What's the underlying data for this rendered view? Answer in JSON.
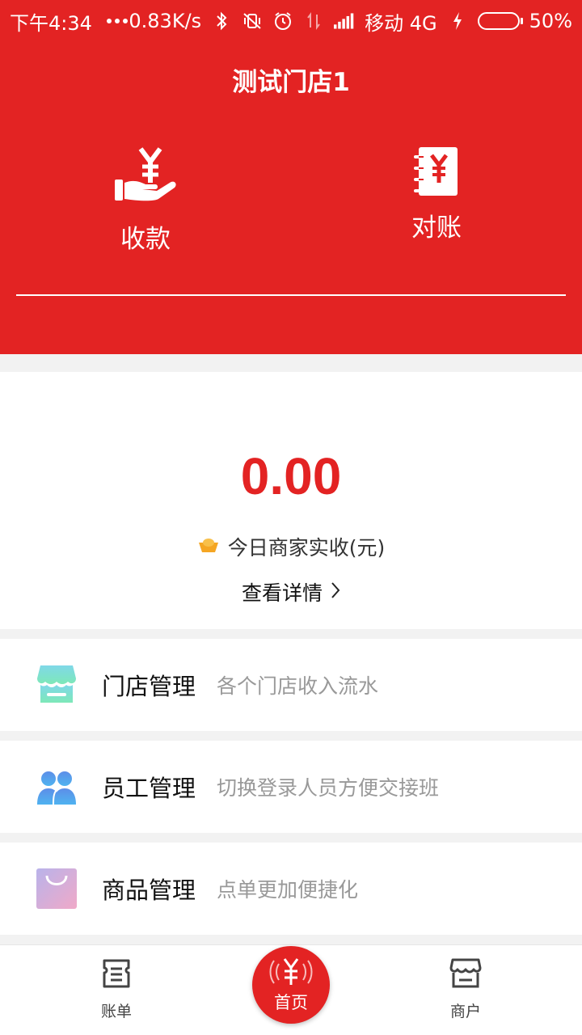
{
  "status_bar": {
    "time": "下午4:34",
    "speed": "0.83K/s",
    "carrier": "移动 4G",
    "battery": "50%",
    "battery_level": 0.5
  },
  "header": {
    "store_name": "测试门店1",
    "actions": [
      {
        "label": "收款",
        "icon": "hand-yuan-icon"
      },
      {
        "label": "对账",
        "icon": "notebook-yuan-icon"
      }
    ]
  },
  "summary": {
    "amount": "0.00",
    "income_label": "今日商家实收(元)",
    "detail_link": "查看详情"
  },
  "menu": [
    {
      "title": "门店管理",
      "desc": "各个门店收入流水",
      "icon": "store-icon"
    },
    {
      "title": "员工管理",
      "desc": "切换登录人员方便交接班",
      "icon": "staff-icon"
    },
    {
      "title": "商品管理",
      "desc": "点单更加便捷化",
      "icon": "shopping-bag-icon"
    }
  ],
  "bottom_nav": {
    "bill": "账单",
    "home": "首页",
    "merchant": "商户"
  },
  "colors": {
    "brand_red": "#e32323",
    "battery_green": "#34c41d"
  }
}
